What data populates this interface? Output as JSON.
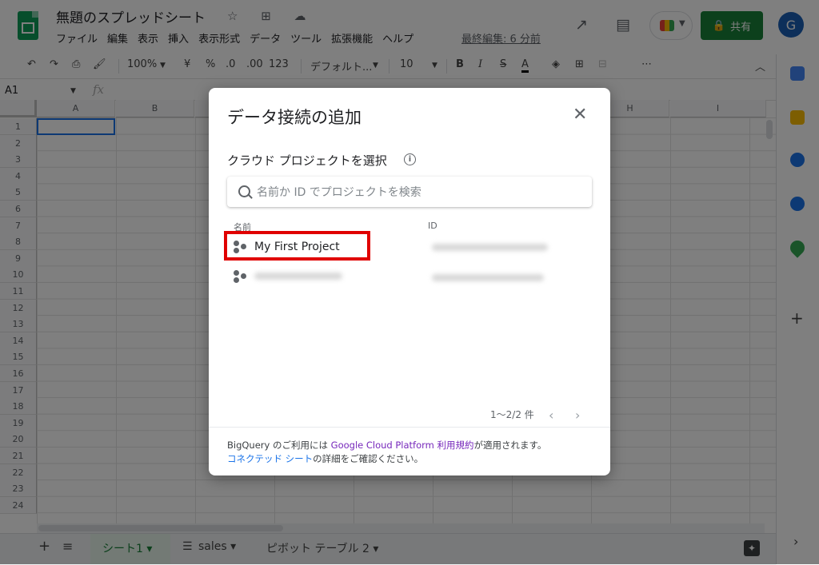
{
  "header": {
    "doc_title": "無題のスプレッドシート",
    "title_icons": "☆ ⊞ ☁",
    "menu": [
      "ファイル",
      "編集",
      "表示",
      "挿入",
      "表示形式",
      "データ",
      "ツール",
      "拡張機能",
      "ヘルプ"
    ],
    "last_edit": "最終編集: 6 分前",
    "share_label": "共有",
    "avatar_letter": "G",
    "icons": [
      "trending-icon",
      "comment-icon",
      "meet-icon",
      "lock-icon"
    ]
  },
  "toolbar": {
    "undo": "↶",
    "redo": "↷",
    "print": "⎙",
    "paint": "🖌",
    "zoom": "100%",
    "currency": "¥",
    "percent": "%",
    "dec_less": ".0",
    "dec_more": ".00",
    "format": "123",
    "font": "デフォルト...",
    "font_size": "10",
    "bold": "B",
    "italic": "I",
    "strike": "S",
    "textcolor": "A",
    "more": "⋯",
    "collapse": "︿"
  },
  "formula_bar": {
    "cell_ref": "A1",
    "fx": "fx"
  },
  "grid": {
    "columns": [
      "A",
      "B",
      "",
      "",
      "",
      "",
      "",
      "H",
      "I"
    ],
    "rows": [
      "1",
      "2",
      "3",
      "4",
      "5",
      "6",
      "7",
      "8",
      "9",
      "10",
      "11",
      "12",
      "13",
      "14",
      "15",
      "16",
      "17",
      "18",
      "19",
      "20",
      "21",
      "22",
      "23",
      "24"
    ]
  },
  "sheet_tabs": {
    "add": "+",
    "all": "≡",
    "tabs": [
      {
        "label": "シート1 ▾",
        "active": true
      },
      {
        "label": "sales ▾",
        "active": false
      },
      {
        "label": "ピボット テーブル 2 ▾",
        "active": false
      }
    ]
  },
  "side_panel": {
    "icons": [
      "calendar-icon",
      "keep-icon",
      "tasks-icon",
      "contacts-icon",
      "maps-icon"
    ],
    "add": "+",
    "expand": "›"
  },
  "dialog": {
    "title": "データ接続の追加",
    "close": "✕",
    "subtitle": "クラウド プロジェクトを選択",
    "info": "i",
    "search_placeholder": "名前か ID でプロジェクトを検索",
    "col_name": "名前",
    "col_id": "ID",
    "projects": [
      {
        "name": "My First Project",
        "highlighted": true
      },
      {
        "name": "",
        "highlighted": false
      }
    ],
    "pager": "1〜2/2 件",
    "prev": "‹",
    "next": "›",
    "terms_1": "BigQuery のご利用には ",
    "terms_link": "Google Cloud Platform 利用規約",
    "terms_2": "が適用されます。",
    "terms_link2": "コネクテッド シート",
    "terms_3": "の詳細をご確認ください。"
  }
}
